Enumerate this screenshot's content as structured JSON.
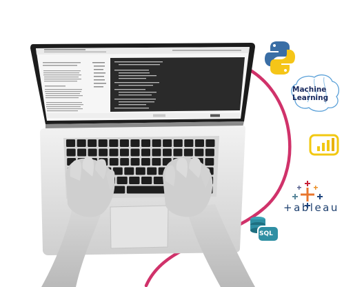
{
  "logos": {
    "python": {
      "icon": "python-logo-icon",
      "colors": [
        "#3a6ea5",
        "#f5c518"
      ]
    },
    "machine_learning": {
      "line1": "Machine",
      "line2": "Learning",
      "icon": "brain-icon",
      "color": "#1a2a5e"
    },
    "power_bi": {
      "icon": "bar-chart-icon",
      "color": "#f2c811"
    },
    "tableau": {
      "text": "+ableau",
      "icon": "tableau-cross-icon",
      "colors": [
        "#e8762d",
        "#1f457e",
        "#59879b",
        "#c72037"
      ]
    },
    "sql": {
      "text": "SQL",
      "icon": "database-icon",
      "colors": [
        "#2f8fa3",
        "#1e6f80"
      ]
    }
  },
  "accent": "#d0326a"
}
